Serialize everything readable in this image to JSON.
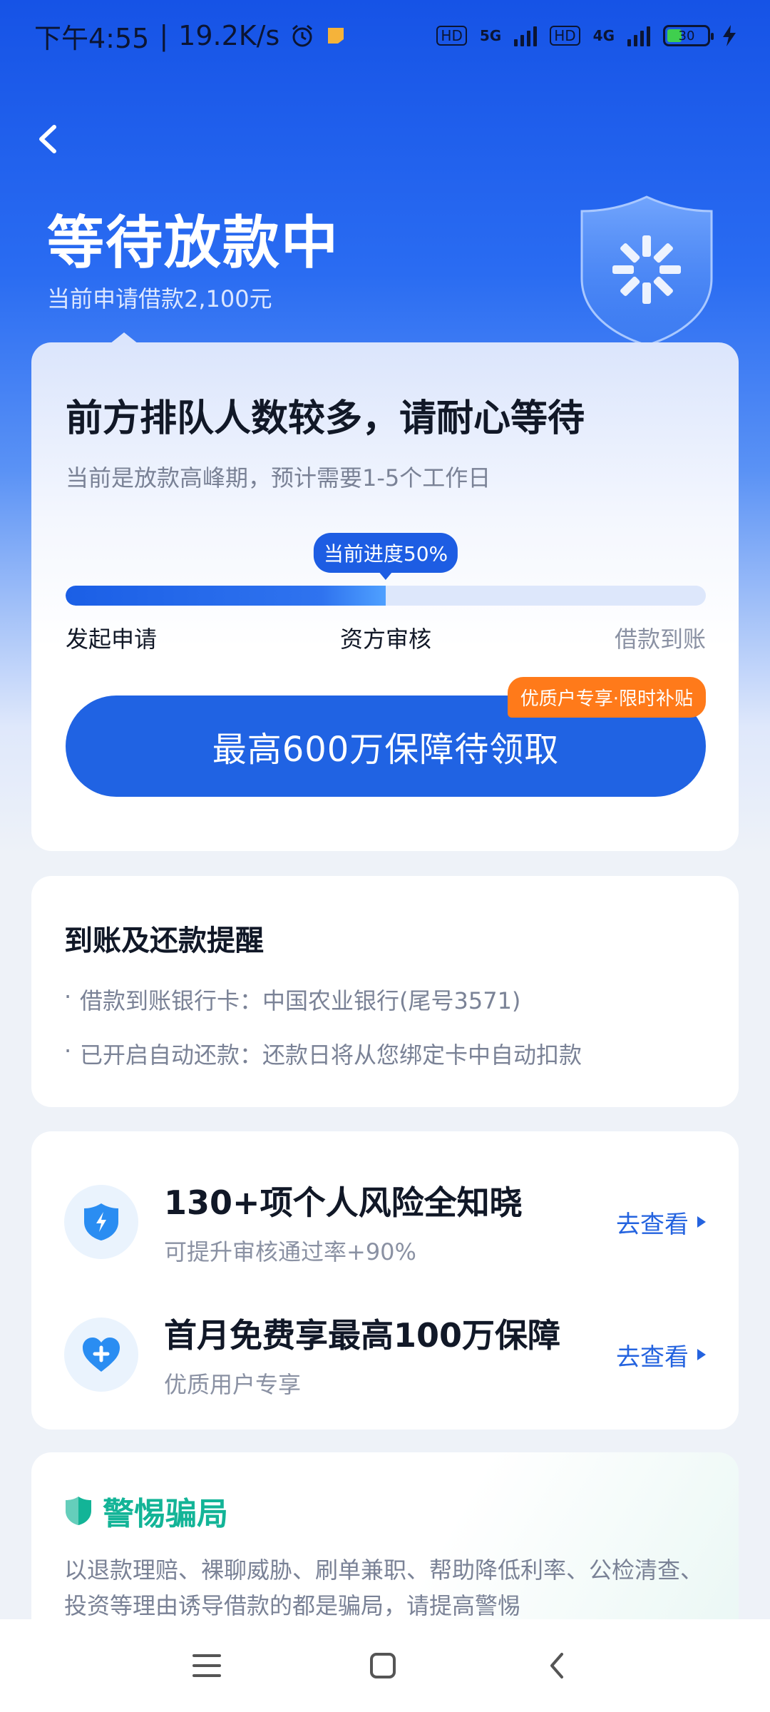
{
  "status_bar": {
    "time": "下午4:55",
    "net_speed": "19.2K/s",
    "hd1": "HD",
    "net1": "5G",
    "hd2": "HD",
    "net2": "4G",
    "battery": "30"
  },
  "header": {
    "title": "等待放款中",
    "subtitle": "当前申请借款2,100元"
  },
  "queue_card": {
    "heading": "前方排队人数较多，请耐心等待",
    "subtext": "当前是放款高峰期，预计需要1-5个工作日",
    "progress_label": "当前进度50%",
    "progress_value": 0.5,
    "steps": [
      "发起申请",
      "资方审核",
      "借款到账"
    ],
    "promo_tag": "优质户专享·限时补贴",
    "claim_button": "最高600万保障待领取"
  },
  "reminder": {
    "title": "到账及还款提醒",
    "items": [
      "借款到账银行卡：中国农业银行(尾号3571)",
      "已开启自动还款：还款日将从您绑定卡中自动扣款"
    ]
  },
  "offers": [
    {
      "title": "130+项个人风险全知晓",
      "subtitle": "可提升审核通过率+90%",
      "link": "去查看",
      "icon": "shield-lightning-icon"
    },
    {
      "title": "首月免费享最高100万保障",
      "subtitle": "优质用户专享",
      "link": "去查看",
      "icon": "heart-plus-icon"
    }
  ],
  "fraud": {
    "title": "警惕骗局",
    "text": "以退款理赔、裸聊威胁、刷单兼职、帮助降低利率、公检清查、投资等理由诱导借款的都是骗局，请提高警惕"
  },
  "colors": {
    "primary": "#2063e3",
    "promo": "#ff7a1a",
    "fraud": "#13b497"
  }
}
